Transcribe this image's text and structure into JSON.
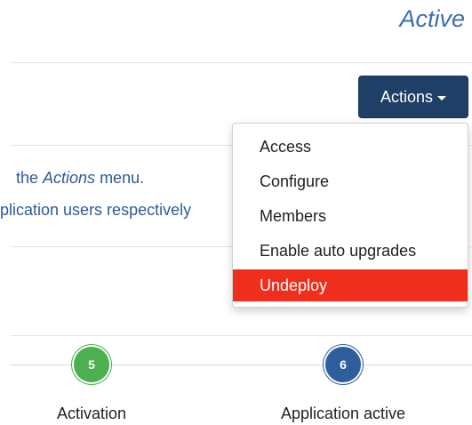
{
  "header": {
    "title": "Active"
  },
  "toolbar": {
    "actions_label": "Actions"
  },
  "info": {
    "line1_prefix": "the ",
    "line1_emphasis": "Actions",
    "line1_suffix": " menu.",
    "line2": "plication users respectively"
  },
  "actions_menu": {
    "items": [
      {
        "label": "Access"
      },
      {
        "label": "Configure"
      },
      {
        "label": "Members"
      },
      {
        "label": "Enable auto upgrades"
      },
      {
        "label": "Undeploy"
      }
    ]
  },
  "steps": [
    {
      "number": "5",
      "label": "Activation",
      "color": "#4caf50"
    },
    {
      "number": "6",
      "label": "Application active",
      "color": "#2f5e9e"
    }
  ],
  "colors": {
    "title": "#3c6eb4",
    "actions_button": "#1f3f66",
    "danger": "#ef2e1c",
    "info_text": "#2d5a9a"
  }
}
